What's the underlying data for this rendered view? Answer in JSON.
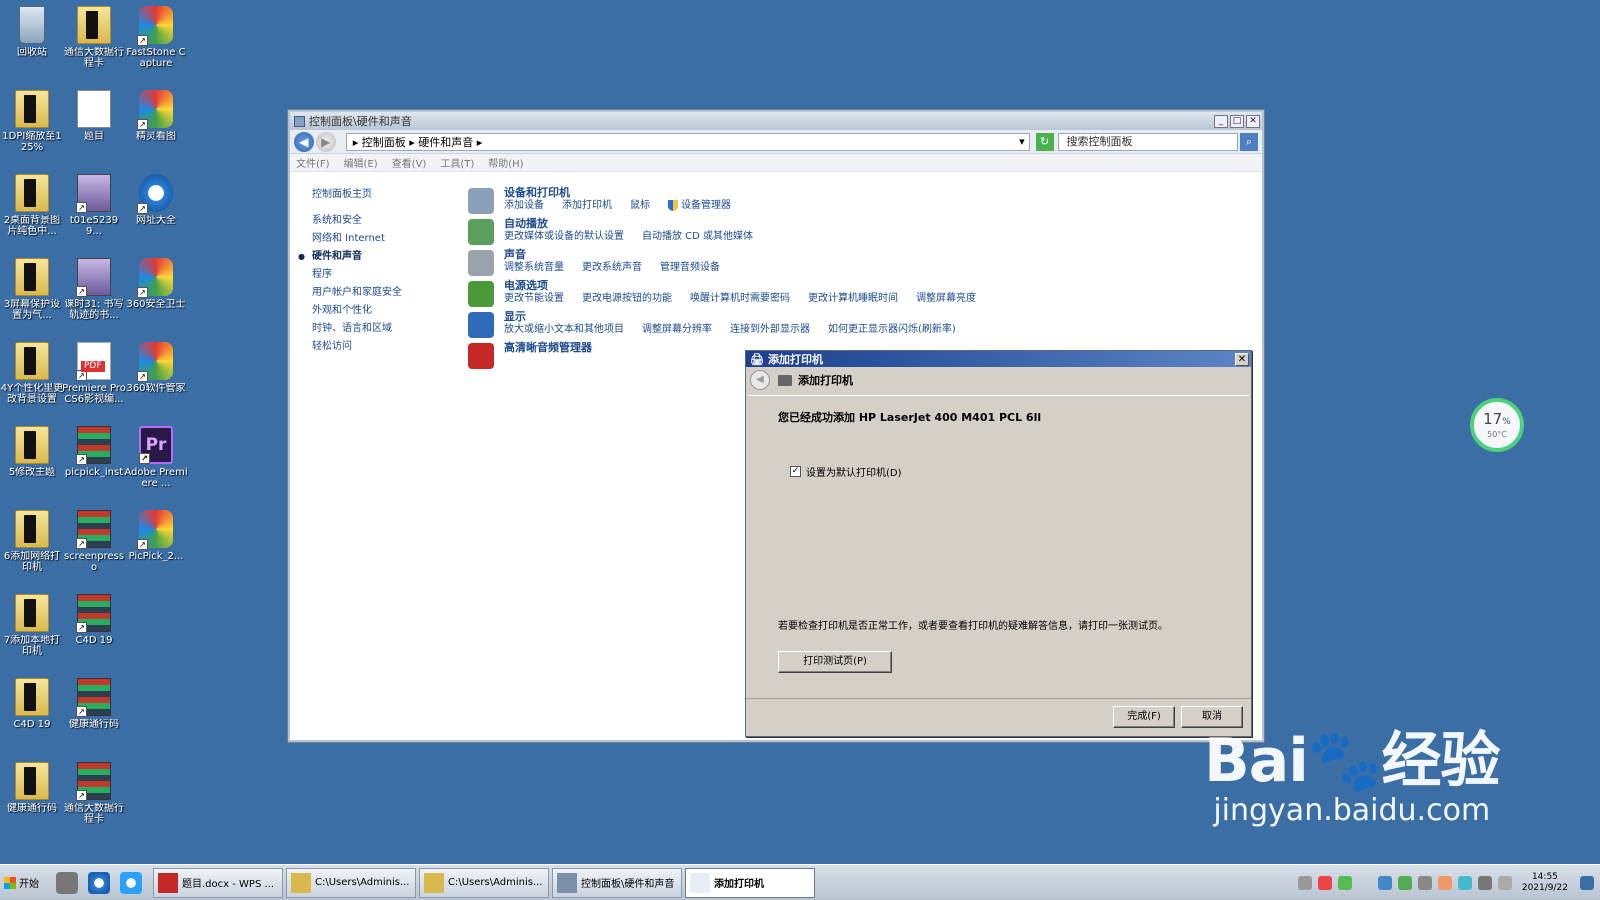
{
  "desktop_icons": [
    {
      "label": "回收站",
      "type": "bin",
      "x": 0,
      "y": 0
    },
    {
      "label": "通信大数据行程卡",
      "type": "folder",
      "x": 1,
      "y": 0
    },
    {
      "label": "FastStone Capture",
      "type": "app",
      "x": 2,
      "y": 0
    },
    {
      "label": "1DPI缩放至125%",
      "type": "folder",
      "x": 0,
      "y": 1
    },
    {
      "label": "题目",
      "type": "doc",
      "x": 1,
      "y": 1
    },
    {
      "label": "精灵看图",
      "type": "app",
      "x": 2,
      "y": 1
    },
    {
      "label": "2桌面背景图片纯色中...",
      "type": "folder",
      "x": 0,
      "y": 2
    },
    {
      "label": "t01e52399...",
      "type": "img",
      "x": 1,
      "y": 2
    },
    {
      "label": "网址大全",
      "type": "ie",
      "x": 2,
      "y": 2
    },
    {
      "label": "3屏幕保护设置为气...",
      "type": "folder",
      "x": 0,
      "y": 3
    },
    {
      "label": "课时31: 书写轨迹的书...",
      "type": "img",
      "x": 1,
      "y": 3
    },
    {
      "label": "360安全卫士",
      "type": "app",
      "x": 2,
      "y": 3
    },
    {
      "label": "4Y个性化里更改背景设置",
      "type": "folder",
      "x": 0,
      "y": 4
    },
    {
      "label": "Premiere Pro CS6影视编...",
      "type": "pdf",
      "x": 1,
      "y": 4
    },
    {
      "label": "360软件管家",
      "type": "app",
      "x": 2,
      "y": 4
    },
    {
      "label": "5修改主题",
      "type": "folder",
      "x": 0,
      "y": 5
    },
    {
      "label": "picpick_inst",
      "type": "rar",
      "x": 1,
      "y": 5
    },
    {
      "label": "Adobe Premiere ...",
      "type": "pr",
      "x": 2,
      "y": 5
    },
    {
      "label": "6添加网络打印机",
      "type": "folder",
      "x": 0,
      "y": 6
    },
    {
      "label": "screenpresso",
      "type": "rar",
      "x": 1,
      "y": 6
    },
    {
      "label": "PicPick_2...",
      "type": "app",
      "x": 2,
      "y": 6
    },
    {
      "label": "7添加本地打印机",
      "type": "folder",
      "x": 0,
      "y": 7
    },
    {
      "label": "C4D 19",
      "type": "rar",
      "x": 1,
      "y": 7
    },
    {
      "label": "C4D 19",
      "type": "folder",
      "x": 0,
      "y": 8
    },
    {
      "label": "健康通行码",
      "type": "rar",
      "x": 1,
      "y": 8
    },
    {
      "label": "健康通行码",
      "type": "folder",
      "x": 0,
      "y": 9
    },
    {
      "label": "通信大数据行程卡",
      "type": "rar",
      "x": 1,
      "y": 9
    }
  ],
  "window": {
    "title": "控制面板\\硬件和声音",
    "address": "▸ 控制面板 ▸ 硬件和声音 ▸",
    "search_placeholder": "搜索控制面板",
    "menu": [
      "文件(F)",
      "编辑(E)",
      "查看(V)",
      "工具(T)",
      "帮助(H)"
    ],
    "left_nav": [
      "控制面板主页",
      "系统和安全",
      "网络和 Internet",
      "硬件和声音",
      "程序",
      "用户帐户和家庭安全",
      "外观和个性化",
      "时钟、语言和区域",
      "轻松访问"
    ],
    "categories": [
      {
        "title": "设备和打印机",
        "links": [
          "添加设备",
          "添加打印机",
          "鼠标",
          "设备管理器"
        ],
        "color": "#8aa0b8"
      },
      {
        "title": "自动播放",
        "links": [
          "更改媒体或设备的默认设置",
          "自动播放 CD 或其他媒体"
        ],
        "color": "#5c9e5c"
      },
      {
        "title": "声音",
        "links": [
          "调整系统音量",
          "更改系统声音",
          "管理音频设备"
        ],
        "color": "#9aa3ab"
      },
      {
        "title": "电源选项",
        "links": [
          "更改节能设置",
          "更改电源按钮的功能",
          "唤醒计算机时需要密码",
          "更改计算机睡眠时间",
          "调整屏幕亮度"
        ],
        "color": "#4a9a3a"
      },
      {
        "title": "显示",
        "links": [
          "放大或缩小文本和其他项目",
          "调整屏幕分辨率",
          "连接到外部显示器",
          "如何更正显示器闪烁(刷新率)"
        ],
        "color": "#2e6bb8"
      },
      {
        "title": "高清晰音频管理器",
        "links": [],
        "color": "#c62828"
      }
    ]
  },
  "dialog": {
    "title": "添加打印机",
    "header": "添加打印机",
    "success": "您已经成功添加 HP LaserJet 400 M401 PCL 6ll",
    "default_checkbox": "设置为默认打印机(D)",
    "hint": "若要检查打印机是否正常工作，或者要查看打印机的疑难解答信息，请打印一张测试页。",
    "test_btn": "打印测试页(P)",
    "finish_btn": "完成(F)",
    "cancel_btn": "取消"
  },
  "taskbar": {
    "start": "开始",
    "tasks": [
      "题目.docx - WPS ...",
      "C:\\Users\\Adminis...",
      "C:\\Users\\Adminis...",
      "控制面板\\硬件和声音",
      "添加打印机"
    ],
    "time": "14:55",
    "date": "2021/9/22"
  },
  "gauge": {
    "value": "17",
    "unit": "%",
    "temp": "50°C"
  },
  "watermark": {
    "brand": "Bai🐾经验",
    "url": "jingyan.baidu.com"
  }
}
